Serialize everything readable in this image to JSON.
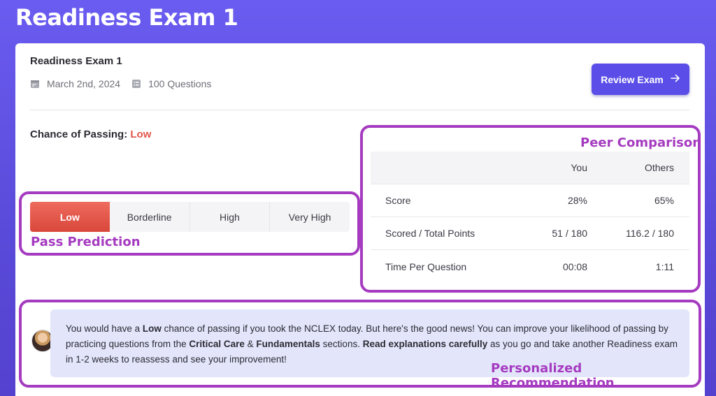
{
  "page": {
    "title": "Readiness Exam 1"
  },
  "exam": {
    "name": "Readiness Exam 1",
    "date": "March 2nd, 2024",
    "questions": "100 Questions",
    "review_label": "Review Exam"
  },
  "chance": {
    "label": "Chance of Passing:",
    "value": "Low"
  },
  "prediction": {
    "options": [
      "Low",
      "Borderline",
      "High",
      "Very High"
    ],
    "selected": "Low"
  },
  "peer": {
    "headers": [
      "",
      "You",
      "Others"
    ],
    "rows": [
      [
        "Score",
        "28%",
        "65%"
      ],
      [
        "Scored / Total Points",
        "51 / 180",
        "116.2 / 180"
      ],
      [
        "Time Per Question",
        "00:08",
        "1:11"
      ]
    ]
  },
  "annotations": {
    "pass": "Pass Prediction",
    "peer": "Peer Comparison",
    "rec": "Personalized Recommendation"
  },
  "recommendation": {
    "t1": "You would have a ",
    "b1": "Low",
    "t2": " chance of passing if you took the NCLEX today. But here's the good news! You can improve your likelihood of passing by practicing questions from the ",
    "b2": "Critical Care",
    "t3": " & ",
    "b3": "Fundamentals",
    "t4": " sections. ",
    "b4": "Read explanations carefully",
    "t5": " as you go and take another Readiness exam in 1-2 weeks to reassess and see your improvement!"
  },
  "colors": {
    "accent": "#5b4ee8",
    "low": "#e0554a",
    "annotation": "#a53bc0"
  },
  "icons": {
    "date": "calendar-icon",
    "questions": "list-icon",
    "review": "arrow-right-icon"
  }
}
